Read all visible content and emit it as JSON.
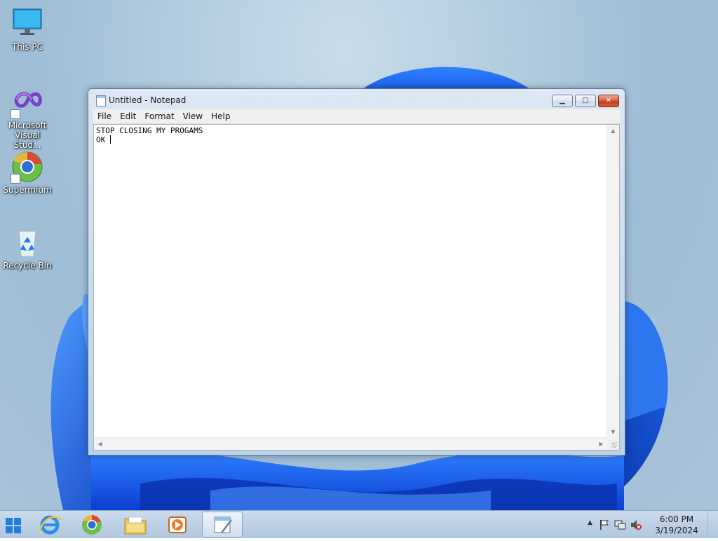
{
  "desktop": {
    "icons": [
      {
        "label": "This PC",
        "icon": "monitor-icon"
      },
      {
        "label": "Microsoft Visual Stud...",
        "icon": "visual-studio-icon"
      },
      {
        "label": "Supermium",
        "icon": "supermium-browser-icon"
      },
      {
        "label": "Recycle Bin",
        "icon": "recycle-bin-icon"
      }
    ]
  },
  "notepad": {
    "title": "Untitled - Notepad",
    "buttons": {
      "minimize": "▁",
      "maximize": "□",
      "close": "✕"
    },
    "menu": [
      "File",
      "Edit",
      "Format",
      "View",
      "Help"
    ],
    "content": {
      "line1": "STOP CLOSING MY PROGAMS",
      "line2": "OK "
    }
  },
  "taskbar": {
    "apps": [
      {
        "icon": "start-windows-icon"
      },
      {
        "icon": "internet-explorer-icon"
      },
      {
        "icon": "supermium-browser-icon"
      },
      {
        "icon": "file-explorer-icon"
      },
      {
        "icon": "media-player-icon"
      },
      {
        "icon": "notepad-icon",
        "active": true
      }
    ],
    "tray": {
      "icons": [
        "show-hidden-icons-chevron-icon",
        "action-center-flag-icon",
        "network-icon",
        "volume-muted-icon"
      ],
      "time": "6:00 PM",
      "date": "3/19/2024"
    }
  },
  "colors": {
    "accent": "#1f5fe0",
    "close_button": "#c23b1b"
  }
}
